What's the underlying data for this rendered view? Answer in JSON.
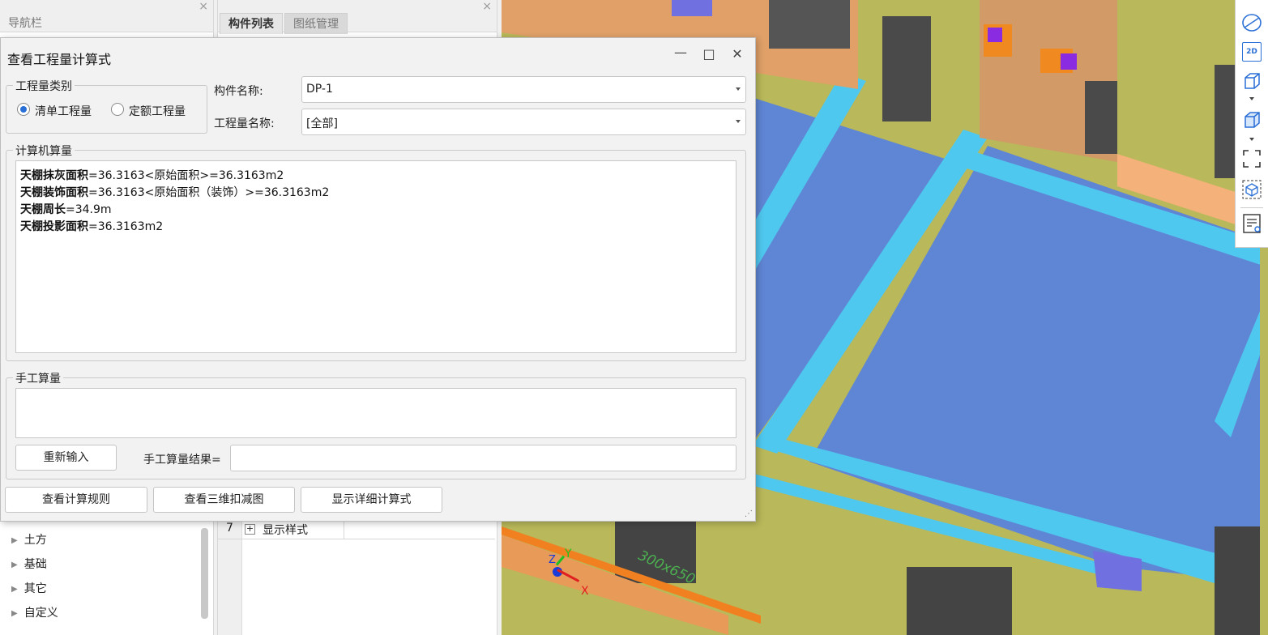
{
  "nav_panel": {
    "title": "导航栏",
    "close": "×",
    "items": [
      {
        "label": "土方"
      },
      {
        "label": "基础"
      },
      {
        "label": "其它"
      },
      {
        "label": "自定义"
      }
    ]
  },
  "component_panel": {
    "close": "×",
    "tabs": [
      "构件列表",
      "图纸管理"
    ],
    "property_row": {
      "index": "7",
      "expand": "+",
      "label": "显示样式"
    }
  },
  "viewport": {
    "beam_label": "300x650",
    "axis_x": "X",
    "axis_y": "Y",
    "axis_z": "Z"
  },
  "toolbar": {
    "icons": [
      "orbit-icon",
      "2d-view-icon",
      "3d-box-icon",
      "3d-box-solid-icon",
      "fit-view-icon",
      "fit-selection-icon",
      "properties-icon"
    ],
    "label_2d": "2D"
  },
  "dialog": {
    "title": "查看工程量计算式",
    "window_controls": {
      "minimize": "—",
      "maximize": "□",
      "close": "✕"
    },
    "quantity_type": {
      "legend": "工程量类别",
      "options": [
        "清单工程量",
        "定额工程量"
      ],
      "selected": 0
    },
    "component_name_label": "构件名称:",
    "component_name_value": "DP-1",
    "quantity_name_label": "工程量名称:",
    "quantity_name_value": "[全部]",
    "computer_calc": {
      "legend": "计算机算量",
      "lines": [
        {
          "name": "天棚抹灰面积",
          "formula": "=36.3163<原始面积>=36.3163m2"
        },
        {
          "name": "天棚装饰面积",
          "formula": "=36.3163<原始面积（装饰）>=36.3163m2"
        },
        {
          "name": "天棚周长",
          "formula": "=34.9m"
        },
        {
          "name": "天棚投影面积",
          "formula": "=36.3163m2"
        }
      ]
    },
    "manual_calc": {
      "legend": "手工算量",
      "reenter_button": "重新输入",
      "result_label": "手工算量结果=",
      "result_value": ""
    },
    "buttons": {
      "view_rules": "查看计算规则",
      "view_3d_deduction": "查看三维扣减图",
      "show_detailed_formula": "显示详细计算式"
    }
  }
}
